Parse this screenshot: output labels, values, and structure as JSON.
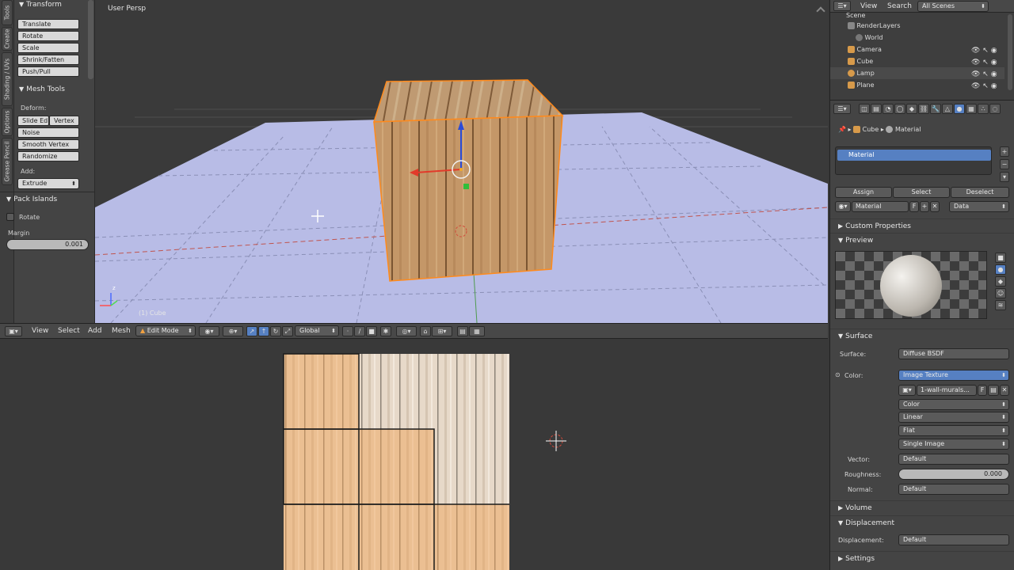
{
  "tool_shelf": {
    "tabs": [
      "Tools",
      "Create",
      "Shading / UVs",
      "Options",
      "Grease Pencil"
    ],
    "transform_header": "Transform",
    "transform_buttons": [
      "Translate",
      "Rotate",
      "Scale",
      "Shrink/Fatten",
      "Push/Pull"
    ],
    "mesh_tools_header": "Mesh Tools",
    "deform_label": "Deform:",
    "slide_edge": "Slide Ed",
    "vertex": "Vertex",
    "noise": "Noise",
    "smooth_vertex": "Smooth Vertex",
    "randomize": "Randomize",
    "add_label": "Add:",
    "extrude": "Extrude",
    "pack_islands_header": "Pack Islands",
    "rotate_label": "Rotate",
    "margin_label": "Margin",
    "margin_value": "0.001"
  },
  "viewport": {
    "view_label": "User Persp",
    "object_label": "(1) Cube",
    "axis_z": "z"
  },
  "viewport_header": {
    "menus": [
      "View",
      "Select",
      "Add",
      "Mesh"
    ],
    "mode": "Edit Mode",
    "orientation": "Global"
  },
  "outliner": {
    "menus": [
      "View",
      "Search"
    ],
    "scene_filter": "All Scenes",
    "rows": [
      "Scene",
      "RenderLayers",
      "World",
      "Camera",
      "Cube",
      "Lamp",
      "Plane"
    ]
  },
  "properties": {
    "breadcrumb_object": "Cube",
    "breadcrumb_material": "Material",
    "material_slot": "Material",
    "assign": "Assign",
    "select": "Select",
    "deselect": "Deselect",
    "material_name": "Material",
    "fake_user": "F",
    "link_mode": "Data",
    "custom_properties": "Custom Properties",
    "preview": "Preview",
    "surface_header": "Surface",
    "surface_label": "Surface:",
    "surface_value": "Diffuse BSDF",
    "color_label": "Color:",
    "color_value": "Image Texture",
    "image_name": "1-wall-murals...",
    "image_f": "F",
    "color_space": "Color",
    "interpolation": "Linear",
    "projection": "Flat",
    "source": "Single Image",
    "vector_label": "Vector:",
    "vector_value": "Default",
    "roughness_label": "Roughness:",
    "roughness_value": "0.000",
    "normal_label": "Normal:",
    "normal_value": "Default",
    "volume_header": "Volume",
    "displacement_header": "Displacement",
    "displacement_label": "Displacement:",
    "displacement_value": "Default",
    "settings_header": "Settings"
  },
  "colors": {
    "selection_blue": "#5680c2",
    "wood": "#c79a69",
    "floor": "#b9bde8",
    "edit_orange": "#ff8a1c"
  }
}
